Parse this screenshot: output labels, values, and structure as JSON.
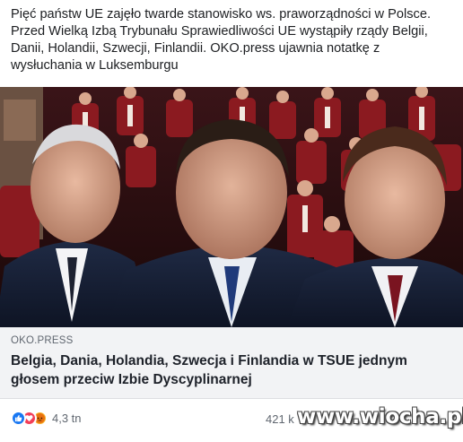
{
  "post": {
    "text": "Pięć państw UE zajęło twarde stanowisko ws. praworządności w Polsce. Przed Wielką Izbą Trybunału Sprawiedliwości UE wystąpiły rządy Belgii, Danii, Holandii, Szwecji, Finlandii. OKO.press ujawnia notatkę z wysłuchania w Luksemburgu"
  },
  "link": {
    "domain": "OKO.PRESS",
    "title": "Belgia, Dania, Holandia, Szwecja i Finlandia w TSUE jednym głosem przeciw Izbie Dyscyplinarnej"
  },
  "footer": {
    "reactions": [
      "like-icon",
      "love-icon",
      "angry-icon"
    ],
    "reaction_count": "4,3 tn",
    "comments_count": "421 k"
  },
  "watermark": "www.wiocha.pl",
  "colors": {
    "link_caption_bg": "#f2f3f5",
    "text": "#1c1e21",
    "secondary_text": "#606770",
    "like": "#1877f2",
    "love": "#f33e58",
    "angry": "#f7b125",
    "tribunal_red": "#8b1a20"
  }
}
